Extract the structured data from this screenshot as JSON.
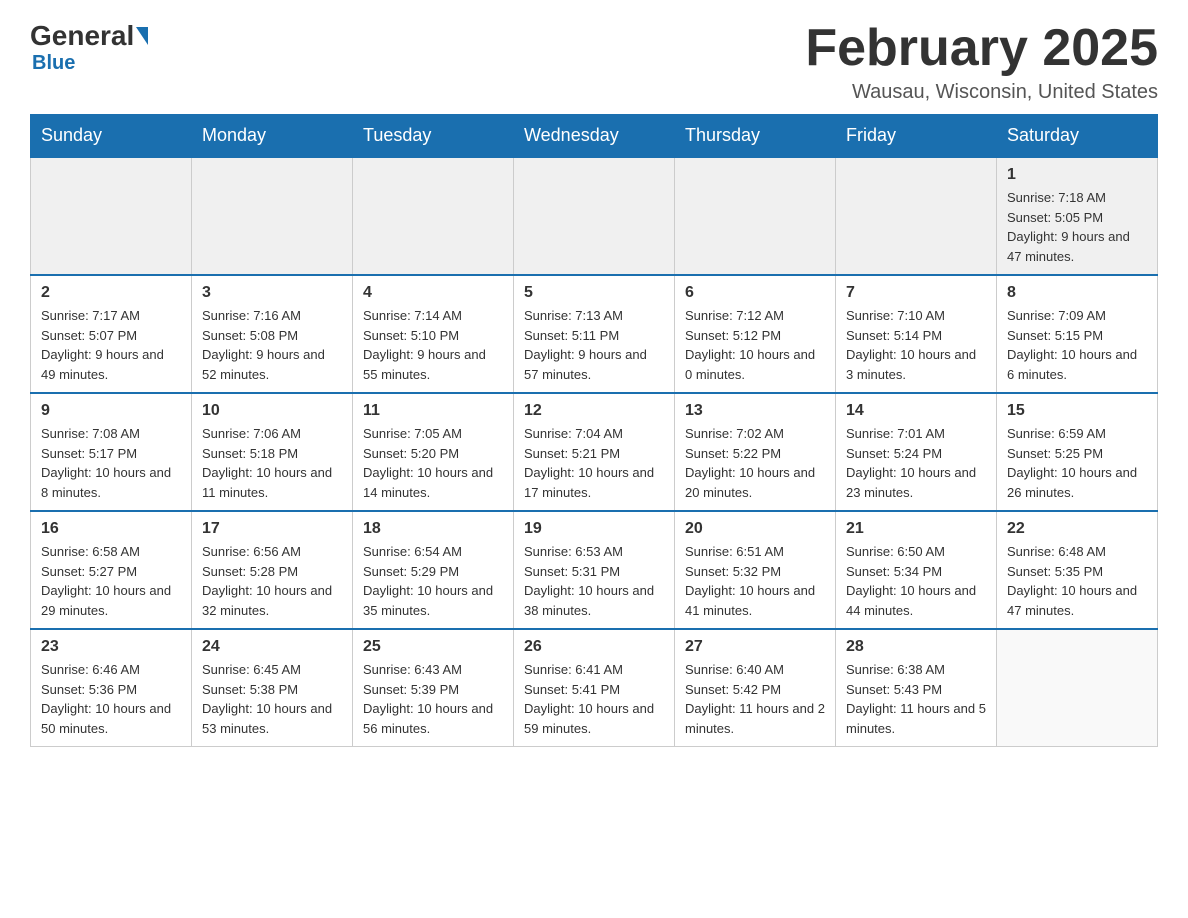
{
  "header": {
    "logo_general": "General",
    "logo_blue": "Blue",
    "title": "February 2025",
    "subtitle": "Wausau, Wisconsin, United States"
  },
  "days_of_week": [
    "Sunday",
    "Monday",
    "Tuesday",
    "Wednesday",
    "Thursday",
    "Friday",
    "Saturday"
  ],
  "weeks": [
    [
      {
        "day": "",
        "info": ""
      },
      {
        "day": "",
        "info": ""
      },
      {
        "day": "",
        "info": ""
      },
      {
        "day": "",
        "info": ""
      },
      {
        "day": "",
        "info": ""
      },
      {
        "day": "",
        "info": ""
      },
      {
        "day": "1",
        "info": "Sunrise: 7:18 AM\nSunset: 5:05 PM\nDaylight: 9 hours and 47 minutes."
      }
    ],
    [
      {
        "day": "2",
        "info": "Sunrise: 7:17 AM\nSunset: 5:07 PM\nDaylight: 9 hours and 49 minutes."
      },
      {
        "day": "3",
        "info": "Sunrise: 7:16 AM\nSunset: 5:08 PM\nDaylight: 9 hours and 52 minutes."
      },
      {
        "day": "4",
        "info": "Sunrise: 7:14 AM\nSunset: 5:10 PM\nDaylight: 9 hours and 55 minutes."
      },
      {
        "day": "5",
        "info": "Sunrise: 7:13 AM\nSunset: 5:11 PM\nDaylight: 9 hours and 57 minutes."
      },
      {
        "day": "6",
        "info": "Sunrise: 7:12 AM\nSunset: 5:12 PM\nDaylight: 10 hours and 0 minutes."
      },
      {
        "day": "7",
        "info": "Sunrise: 7:10 AM\nSunset: 5:14 PM\nDaylight: 10 hours and 3 minutes."
      },
      {
        "day": "8",
        "info": "Sunrise: 7:09 AM\nSunset: 5:15 PM\nDaylight: 10 hours and 6 minutes."
      }
    ],
    [
      {
        "day": "9",
        "info": "Sunrise: 7:08 AM\nSunset: 5:17 PM\nDaylight: 10 hours and 8 minutes."
      },
      {
        "day": "10",
        "info": "Sunrise: 7:06 AM\nSunset: 5:18 PM\nDaylight: 10 hours and 11 minutes."
      },
      {
        "day": "11",
        "info": "Sunrise: 7:05 AM\nSunset: 5:20 PM\nDaylight: 10 hours and 14 minutes."
      },
      {
        "day": "12",
        "info": "Sunrise: 7:04 AM\nSunset: 5:21 PM\nDaylight: 10 hours and 17 minutes."
      },
      {
        "day": "13",
        "info": "Sunrise: 7:02 AM\nSunset: 5:22 PM\nDaylight: 10 hours and 20 minutes."
      },
      {
        "day": "14",
        "info": "Sunrise: 7:01 AM\nSunset: 5:24 PM\nDaylight: 10 hours and 23 minutes."
      },
      {
        "day": "15",
        "info": "Sunrise: 6:59 AM\nSunset: 5:25 PM\nDaylight: 10 hours and 26 minutes."
      }
    ],
    [
      {
        "day": "16",
        "info": "Sunrise: 6:58 AM\nSunset: 5:27 PM\nDaylight: 10 hours and 29 minutes."
      },
      {
        "day": "17",
        "info": "Sunrise: 6:56 AM\nSunset: 5:28 PM\nDaylight: 10 hours and 32 minutes."
      },
      {
        "day": "18",
        "info": "Sunrise: 6:54 AM\nSunset: 5:29 PM\nDaylight: 10 hours and 35 minutes."
      },
      {
        "day": "19",
        "info": "Sunrise: 6:53 AM\nSunset: 5:31 PM\nDaylight: 10 hours and 38 minutes."
      },
      {
        "day": "20",
        "info": "Sunrise: 6:51 AM\nSunset: 5:32 PM\nDaylight: 10 hours and 41 minutes."
      },
      {
        "day": "21",
        "info": "Sunrise: 6:50 AM\nSunset: 5:34 PM\nDaylight: 10 hours and 44 minutes."
      },
      {
        "day": "22",
        "info": "Sunrise: 6:48 AM\nSunset: 5:35 PM\nDaylight: 10 hours and 47 minutes."
      }
    ],
    [
      {
        "day": "23",
        "info": "Sunrise: 6:46 AM\nSunset: 5:36 PM\nDaylight: 10 hours and 50 minutes."
      },
      {
        "day": "24",
        "info": "Sunrise: 6:45 AM\nSunset: 5:38 PM\nDaylight: 10 hours and 53 minutes."
      },
      {
        "day": "25",
        "info": "Sunrise: 6:43 AM\nSunset: 5:39 PM\nDaylight: 10 hours and 56 minutes."
      },
      {
        "day": "26",
        "info": "Sunrise: 6:41 AM\nSunset: 5:41 PM\nDaylight: 10 hours and 59 minutes."
      },
      {
        "day": "27",
        "info": "Sunrise: 6:40 AM\nSunset: 5:42 PM\nDaylight: 11 hours and 2 minutes."
      },
      {
        "day": "28",
        "info": "Sunrise: 6:38 AM\nSunset: 5:43 PM\nDaylight: 11 hours and 5 minutes."
      },
      {
        "day": "",
        "info": ""
      }
    ]
  ]
}
